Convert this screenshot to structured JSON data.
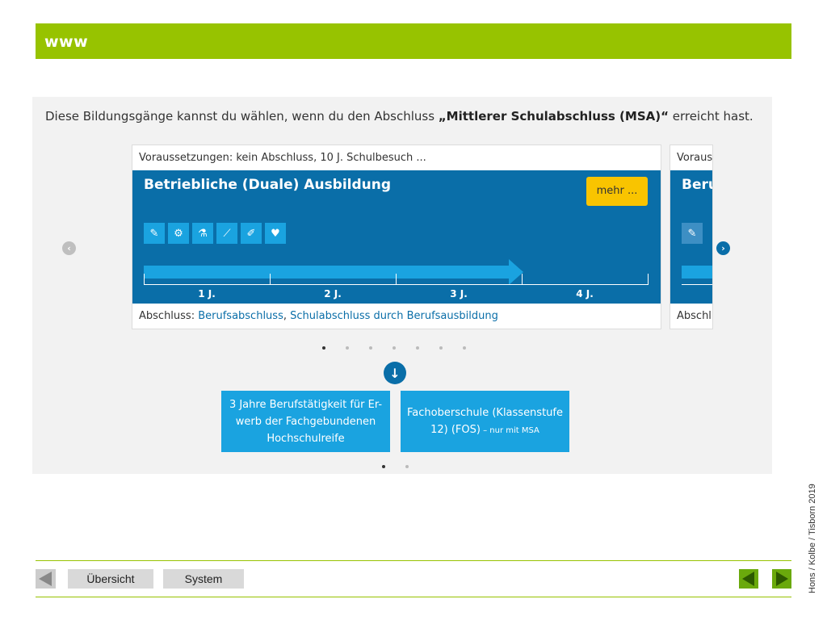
{
  "header": {
    "title": "www"
  },
  "intro": {
    "prefix": "Diese Bildungsgänge kannst du wählen, wenn du den Abschluss ",
    "highlight": "„Mittlerer Schulabschluss (MSA)“",
    "suffix": " erreicht hast."
  },
  "card": {
    "requirements": "Voraussetzungen: kein Abschluss, 10 J. Schulbesuch ...",
    "title": "Betriebliche (Duale) Ausbildung",
    "more_button": "mehr ...",
    "icons": [
      "syringe-icon",
      "gears-icon",
      "flask-icon",
      "chart-icon",
      "pen-icon",
      "heartbeat-icon"
    ],
    "years": [
      "1 J.",
      "2 J.",
      "3 J.",
      "4 J."
    ],
    "duration_years": 3,
    "degree_label": "Abschluss: ",
    "degree_link_1": "Berufsabschluss",
    "degree_sep": ", ",
    "degree_link_2": "Schulabschluss durch Berufsausbildung"
  },
  "next_card": {
    "requirements": "Voraus",
    "title": "Beru",
    "degree": "Abschl"
  },
  "carousel": {
    "slide_count": 7,
    "active_index": 0
  },
  "options": [
    {
      "text": "3 Jahre Berufstätigkeit für Er-werb der Fachgebundenen Hochschulreife",
      "note": ""
    },
    {
      "text": "Fachoberschule (Klassenstufe 12) (FOS)",
      "note": " – nur mit MSA"
    }
  ],
  "options_carousel": {
    "slide_count": 2,
    "active_index": 0
  },
  "footer": {
    "overview_label": "Übersicht",
    "system_label": "System",
    "credit": "Hons / Kolbe / Tisborn 2019"
  },
  "colors": {
    "brand_green": "#97c300",
    "blue": "#0a6ea8",
    "light_blue": "#1aa3e0",
    "yellow": "#f9c400"
  }
}
